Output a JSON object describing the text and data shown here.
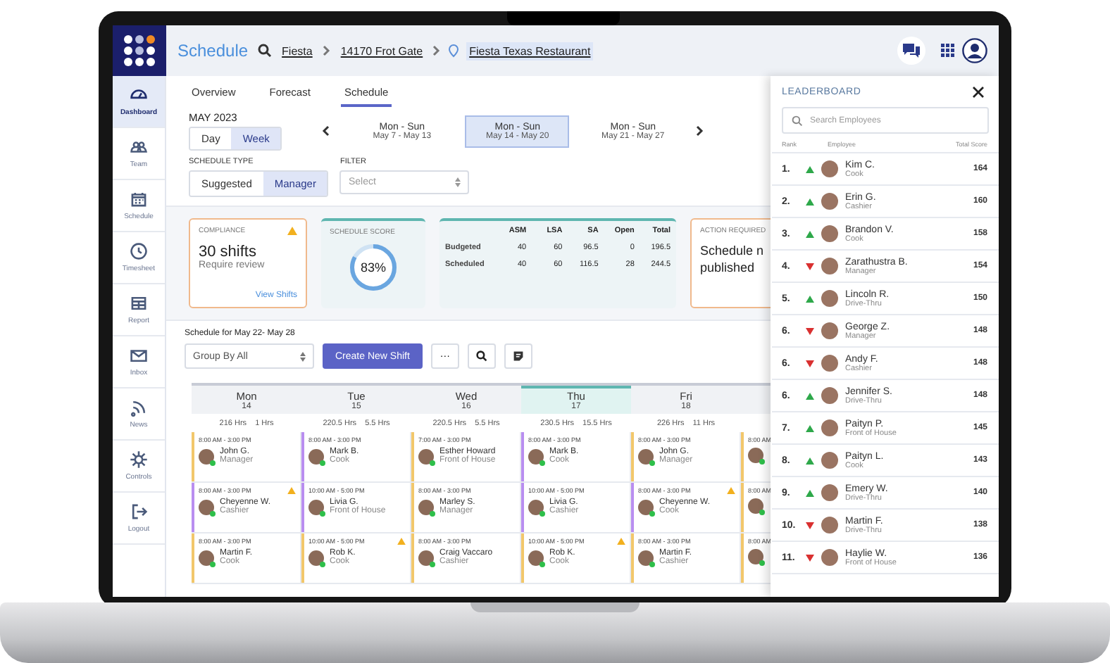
{
  "topbar": {
    "title": "Schedule",
    "breadcrumbs": [
      {
        "label": "Fiesta",
        "selected": false
      },
      {
        "label": "14170 Frot Gate",
        "selected": false
      },
      {
        "label": "Fiesta Texas Restaurant",
        "selected": true
      }
    ]
  },
  "sidebar": {
    "items": [
      {
        "label": "Dashboard",
        "selected": true
      },
      {
        "label": "Team",
        "selected": false
      },
      {
        "label": "Schedule",
        "selected": false
      },
      {
        "label": "Timesheet",
        "selected": false
      },
      {
        "label": "Report",
        "selected": false
      },
      {
        "label": "Inbox",
        "selected": false
      },
      {
        "label": "News",
        "selected": false
      },
      {
        "label": "Controls",
        "selected": false
      },
      {
        "label": "Logout",
        "selected": false
      }
    ]
  },
  "tabs": [
    {
      "label": "Overview",
      "selected": false
    },
    {
      "label": "Forecast",
      "selected": false
    },
    {
      "label": "Schedule",
      "selected": true
    }
  ],
  "month": "MAY 2023",
  "view_toggle": [
    {
      "label": "Day",
      "selected": false
    },
    {
      "label": "Week",
      "selected": true
    }
  ],
  "weeks": [
    {
      "label": "Mon - Sun",
      "range": "May 7 - May 13",
      "selected": false
    },
    {
      "label": "Mon - Sun",
      "range": "May 14 - May 20",
      "selected": true
    },
    {
      "label": "Mon - Sun",
      "range": "May 21 - May 27",
      "selected": false
    }
  ],
  "schedule_type": {
    "label": "SCHEDULE TYPE",
    "options": [
      {
        "label": "Suggested",
        "selected": false
      },
      {
        "label": "Manager",
        "selected": true
      }
    ]
  },
  "filter": {
    "label": "FILTER",
    "placeholder": "Select"
  },
  "compliance": {
    "label": "COMPLIANCE",
    "value": "30 shifts",
    "note": "Require review",
    "link": "View Shifts"
  },
  "schedule_score": {
    "label": "SCHEDULE SCORE",
    "value": "83%",
    "level": 0.83
  },
  "hours_table": {
    "columns": [
      "ASM",
      "LSA",
      "SA",
      "Open",
      "Total"
    ],
    "rows": [
      {
        "label": "Budgeted",
        "cells": [
          "40",
          "60",
          "96.5",
          "0",
          "196.5"
        ]
      },
      {
        "label": "Scheduled",
        "cells": [
          "40",
          "60",
          "116.5",
          "28",
          "244.5"
        ]
      }
    ]
  },
  "action_required": {
    "label": "ACTION REQUIRED",
    "lines": [
      "Schedule n",
      "published"
    ]
  },
  "section_title": "Schedule for May 22- May 28",
  "group_by": "Group By All",
  "create_button": "Create New Shift",
  "more_button": "···",
  "days": [
    {
      "name": "Mon",
      "date": "14",
      "hours": "216 Hrs",
      "extra": "1 Hrs",
      "selected": false,
      "shifts": [
        {
          "time": "8:00 AM - 3:00 PM",
          "name": "John G.",
          "role": "Manager",
          "color": "#f2c76b",
          "warning": false
        },
        {
          "time": "8:00 AM - 3:00 PM",
          "name": "Cheyenne W.",
          "role": "Cashier",
          "color": "#b98ef0",
          "warning": true
        },
        {
          "time": "8:00 AM - 3:00 PM",
          "name": "Martin F.",
          "role": "Cook",
          "color": "#f2c76b",
          "warning": false
        }
      ]
    },
    {
      "name": "Tue",
      "date": "15",
      "hours": "220.5 Hrs",
      "extra": "5.5 Hrs",
      "selected": false,
      "shifts": [
        {
          "time": "8:00 AM - 3:00 PM",
          "name": "Mark B.",
          "role": "Cook",
          "color": "#b98ef0",
          "warning": false
        },
        {
          "time": "10:00 AM - 5:00 PM",
          "name": "Livia G.",
          "role": "Front of House",
          "color": "#b98ef0",
          "warning": false
        },
        {
          "time": "10:00 AM - 5:00 PM",
          "name": "Rob K.",
          "role": "Cook",
          "color": "#f2c76b",
          "warning": true
        }
      ]
    },
    {
      "name": "Wed",
      "date": "16",
      "hours": "220.5 Hrs",
      "extra": "5.5 Hrs",
      "selected": false,
      "shifts": [
        {
          "time": "7:00 AM - 3:00 PM",
          "name": "Esther Howard",
          "role": "Front of House",
          "color": "#f2c76b",
          "warning": false
        },
        {
          "time": "8:00 AM - 3:00 PM",
          "name": "Marley S.",
          "role": "Manager",
          "color": "#f2c76b",
          "warning": false
        },
        {
          "time": "8:00 AM - 3:00 PM",
          "name": "Craig Vaccaro",
          "role": "Cashier",
          "color": "#f2c76b",
          "warning": false
        }
      ]
    },
    {
      "name": "Thu",
      "date": "17",
      "hours": "230.5 Hrs",
      "extra": "15.5 Hrs",
      "selected": true,
      "shifts": [
        {
          "time": "8:00 AM - 3:00 PM",
          "name": "Mark B.",
          "role": "Cook",
          "color": "#b98ef0",
          "warning": false
        },
        {
          "time": "10:00 AM - 5:00 PM",
          "name": "Livia G.",
          "role": "Cashier",
          "color": "#b98ef0",
          "warning": false
        },
        {
          "time": "10:00 AM - 5:00 PM",
          "name": "Rob K.",
          "role": "Cook",
          "color": "#f2c76b",
          "warning": true
        }
      ]
    },
    {
      "name": "Fri",
      "date": "18",
      "hours": "226 Hrs",
      "extra": "11 Hrs",
      "selected": false,
      "shifts": [
        {
          "time": "8:00 AM - 3:00 PM",
          "name": "John G.",
          "role": "Manager",
          "color": "#f2c76b",
          "warning": false
        },
        {
          "time": "8:00 AM - 3:00 PM",
          "name": "Cheyenne W.",
          "role": "Cook",
          "color": "#b98ef0",
          "warning": true
        },
        {
          "time": "8:00 AM - 3:00 PM",
          "name": "Martin F.",
          "role": "Cashier",
          "color": "#f2c76b",
          "warning": false
        }
      ]
    }
  ],
  "partial_day": {
    "shifts": [
      {
        "time": "8:00 AM",
        "color": "#f2c76b"
      },
      {
        "time": "8:00 AM",
        "color": "#f2c76b"
      },
      {
        "time": "8:00 AM",
        "color": "#f2c76b"
      }
    ]
  },
  "leaderboard": {
    "title": "LEADERBOARD",
    "search_placeholder": "Search Employees",
    "columns": [
      "Rank",
      "Employee",
      "Total Score"
    ],
    "rows": [
      {
        "rank": "1.",
        "rising": true,
        "name": "Kim C.",
        "role": "Cook",
        "score": "164"
      },
      {
        "rank": "2.",
        "rising": true,
        "name": "Erin G.",
        "role": "Cashier",
        "score": "160"
      },
      {
        "rank": "3.",
        "rising": true,
        "name": "Brandon V.",
        "role": "Cook",
        "score": "158"
      },
      {
        "rank": "4.",
        "rising": false,
        "name": "Zarathustra B.",
        "role": "Manager",
        "score": "154"
      },
      {
        "rank": "5.",
        "rising": true,
        "name": "Lincoln R.",
        "role": "Drive-Thru",
        "score": "150"
      },
      {
        "rank": "6.",
        "rising": false,
        "name": "George Z.",
        "role": "Manager",
        "score": "148"
      },
      {
        "rank": "6.",
        "rising": false,
        "name": "Andy F.",
        "role": "Cashier",
        "score": "148"
      },
      {
        "rank": "6.",
        "rising": true,
        "name": "Jennifer S.",
        "role": "Drive-Thru",
        "score": "148"
      },
      {
        "rank": "7.",
        "rising": true,
        "name": "Paityn P.",
        "role": "Front of House",
        "score": "145"
      },
      {
        "rank": "8.",
        "rising": true,
        "name": "Paityn L.",
        "role": "Cook",
        "score": "143"
      },
      {
        "rank": "9.",
        "rising": true,
        "name": "Emery W.",
        "role": "Drive-Thru",
        "score": "140"
      },
      {
        "rank": "10.",
        "rising": false,
        "name": "Martin F.",
        "role": "Drive-Thru",
        "score": "138"
      },
      {
        "rank": "11.",
        "rising": false,
        "name": "Haylie W.",
        "role": "Front of House",
        "score": "136"
      }
    ]
  }
}
